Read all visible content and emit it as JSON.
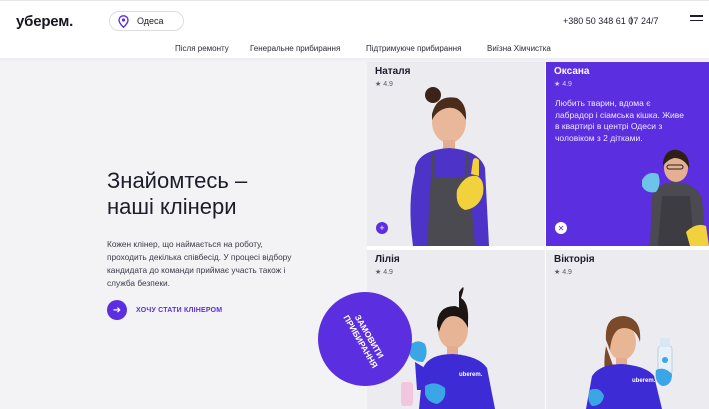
{
  "header": {
    "logo": "уберем.",
    "city": "Одеса",
    "phone": "+380 50 348 61 07",
    "separator": "|",
    "hours": "24/7"
  },
  "nav": {
    "items": [
      {
        "label": "Після ремонту"
      },
      {
        "label": "Генеральне прибирання"
      },
      {
        "label": "Підтримуюче прибирання"
      },
      {
        "label": "Виїзна Хімчистка"
      }
    ]
  },
  "intro": {
    "title_line1": "Знайомтесь –",
    "title_line2": "наші клінери",
    "description": "Кожен клінер, що наймається на роботу, проходить декілька співбесід. У процесі відбору кандидата до команди приймає участь також і служба безпеки.",
    "become_label": "ХОЧУ СТАТИ КЛІНЕРОМ"
  },
  "cleaners": [
    {
      "name": "Наталя",
      "rating": "★ 4.9"
    },
    {
      "name": "Оксана",
      "rating": "★ 4.9",
      "bio": "Любить тварин, вдома є лабрадор і сіамська кішка. Живе в квартирі в центрі Одеси з чоловіком з 2 дітками."
    },
    {
      "name": "Лілія",
      "rating": "★ 4.9"
    },
    {
      "name": "Вікторія",
      "rating": "★ 4.9"
    }
  ],
  "order": {
    "line1": "ЗАМОВИТИ",
    "line2": "ПРИБИРАННЯ"
  },
  "uniform_text": "uberem.",
  "colors": {
    "accent": "#5b2ee0",
    "card_bg": "#ebebf0",
    "intro_bg": "#f3f3f6",
    "glove_yellow": "#f2d23c",
    "glove_blue": "#3aa6e6",
    "apron_gray": "#4a4a50"
  }
}
